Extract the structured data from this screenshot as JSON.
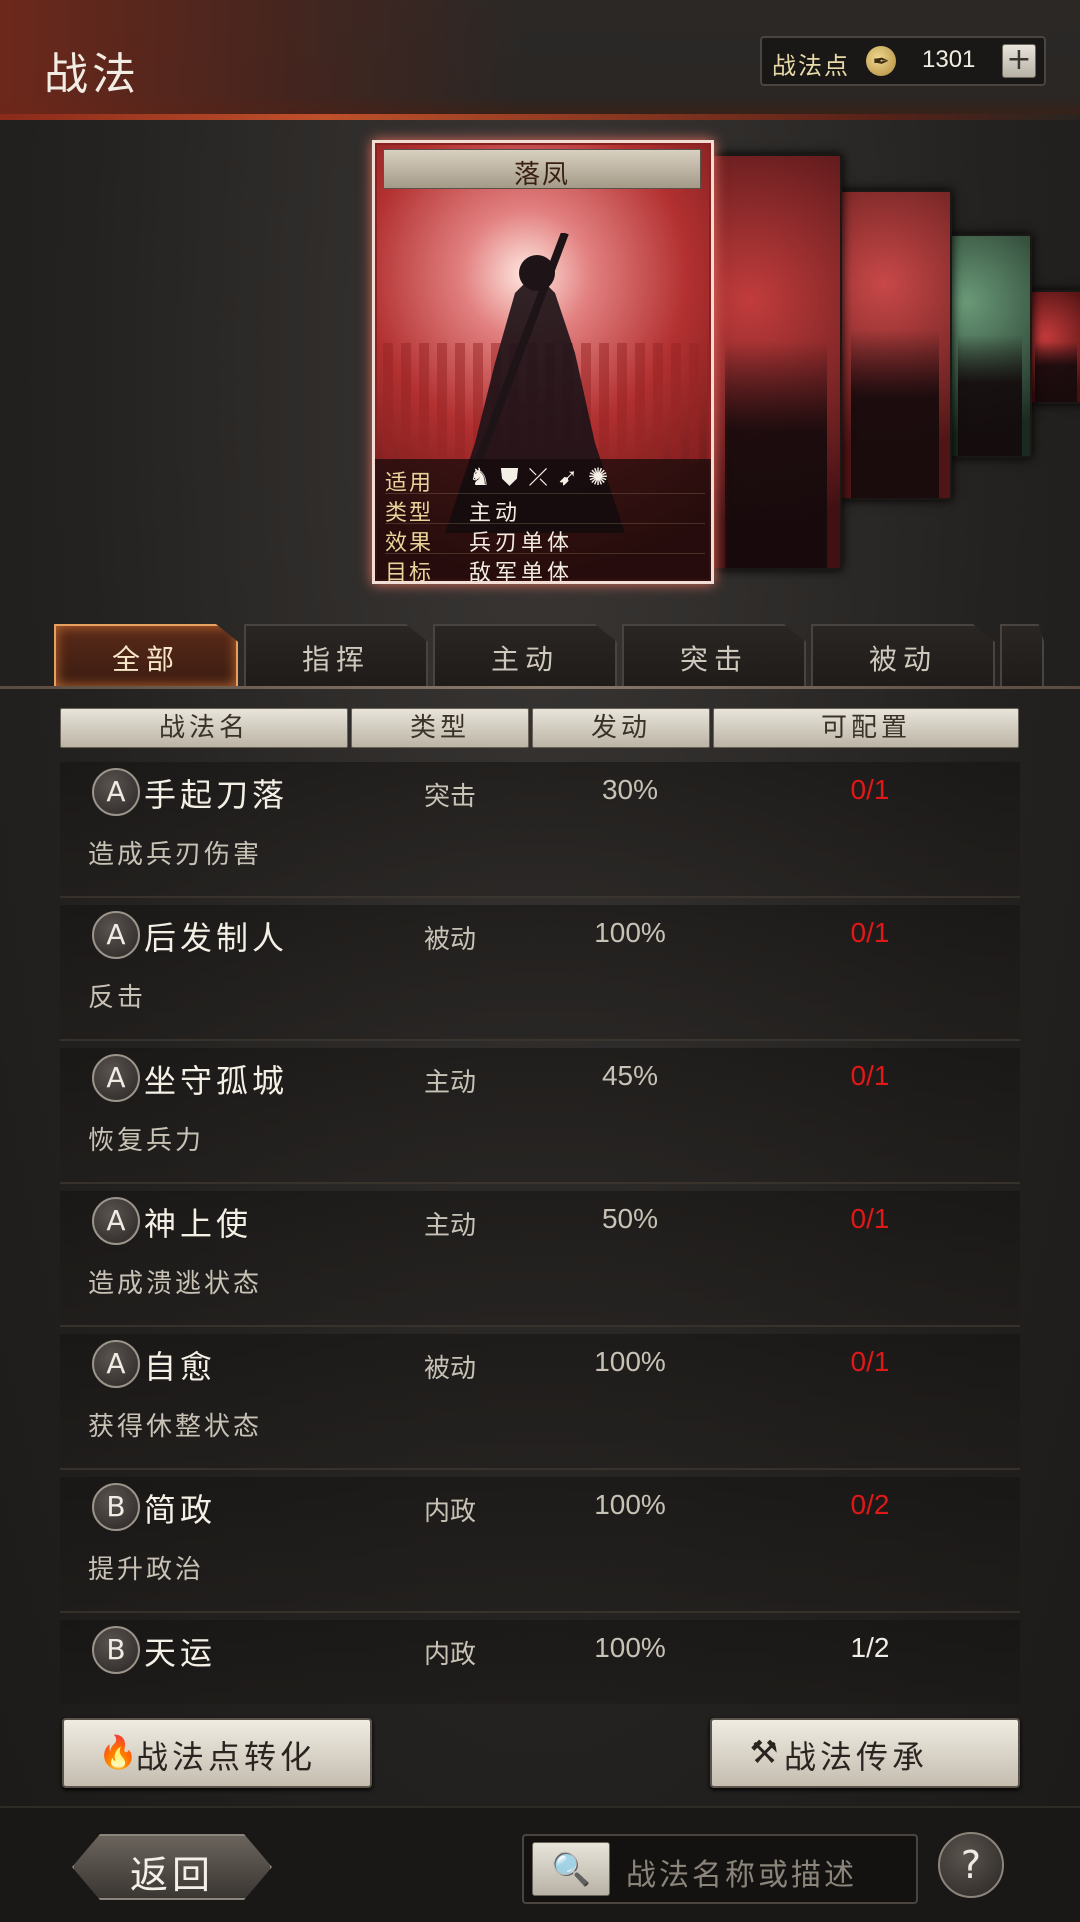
{
  "header": {
    "title": "战法",
    "points_label": "战法点",
    "points_icon": "quill-coin-icon",
    "points_value": "1301",
    "plus_label": "+"
  },
  "card": {
    "name": "落凤",
    "info": [
      {
        "key": "适用",
        "icons": [
          "♞",
          "⛊",
          "⤫",
          "➹",
          "✺"
        ],
        "icon_names": [
          "cavalry-icon",
          "shield-icon",
          "bow-icon",
          "spear-icon",
          "wheel-icon"
        ]
      },
      {
        "key": "类型",
        "value": "主动"
      },
      {
        "key": "效果",
        "value": "兵刃单体"
      },
      {
        "key": "目标",
        "value": "敌军单体"
      }
    ]
  },
  "tabs": [
    {
      "label": "全部",
      "active": true
    },
    {
      "label": "指挥",
      "active": false
    },
    {
      "label": "主动",
      "active": false
    },
    {
      "label": "突击",
      "active": false
    },
    {
      "label": "被动",
      "active": false
    }
  ],
  "table_headers": [
    "战法名",
    "类型",
    "发动",
    "可配置"
  ],
  "skills": [
    {
      "grade": "A",
      "name": "手起刀落",
      "type": "突击",
      "rate": "30%",
      "slot": "0/1",
      "slot_color": "#e01818",
      "desc": "造成兵刃伤害"
    },
    {
      "grade": "A",
      "name": "后发制人",
      "type": "被动",
      "rate": "100%",
      "slot": "0/1",
      "slot_color": "#e01818",
      "desc": "反击"
    },
    {
      "grade": "A",
      "name": "坐守孤城",
      "type": "主动",
      "rate": "45%",
      "slot": "0/1",
      "slot_color": "#e01818",
      "desc": "恢复兵力"
    },
    {
      "grade": "A",
      "name": "神上使",
      "type": "主动",
      "rate": "50%",
      "slot": "0/1",
      "slot_color": "#e01818",
      "desc": "造成溃逃状态"
    },
    {
      "grade": "A",
      "name": "自愈",
      "type": "被动",
      "rate": "100%",
      "slot": "0/1",
      "slot_color": "#e01818",
      "desc": "获得休整状态"
    },
    {
      "grade": "B",
      "name": "简政",
      "type": "内政",
      "rate": "100%",
      "slot": "0/2",
      "slot_color": "#e01818",
      "desc": "提升政治"
    },
    {
      "grade": "B",
      "name": "天运",
      "type": "内政",
      "rate": "100%",
      "slot": "1/2",
      "slot_color": "#f0ece4",
      "desc": ""
    }
  ],
  "buttons": {
    "convert_label": "战法点转化",
    "convert_icon": "flame-coin-icon",
    "inherit_label": "战法传承",
    "inherit_icon": "hammer-icon"
  },
  "footer": {
    "back_label": "返回",
    "search_placeholder": "战法名称或描述",
    "search_icon": "search-icon",
    "help_label": "?"
  }
}
